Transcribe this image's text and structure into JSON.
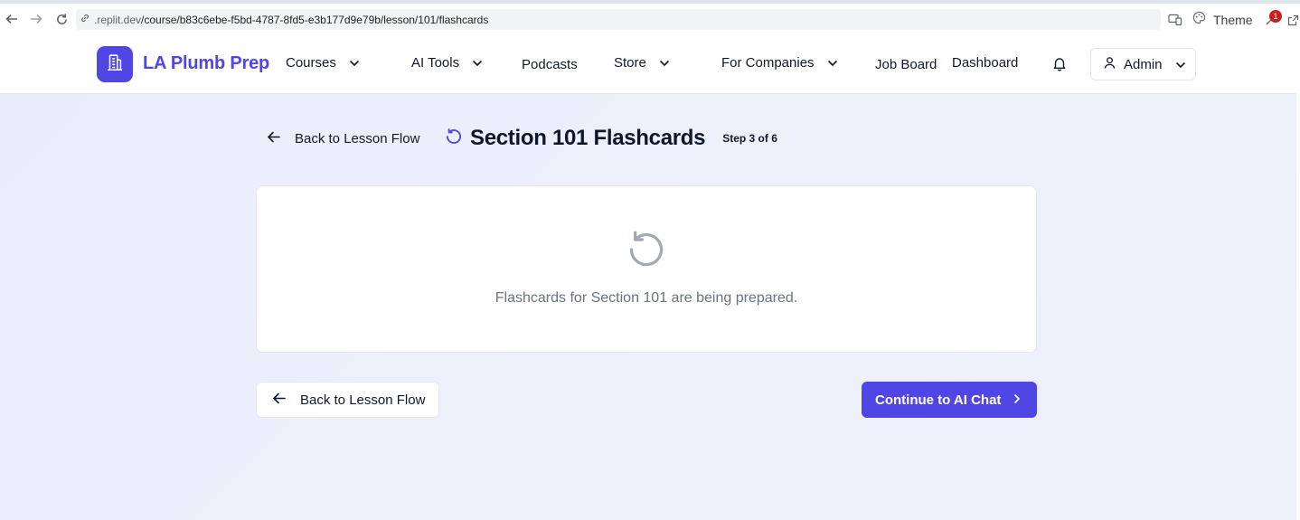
{
  "browser": {
    "url_host": ".replit.dev",
    "url_path": "/course/b83c6ebe-f5bd-4787-8fd5-e3b177d9e79b/lesson/101/flashcards",
    "theme_label": "Theme",
    "extension_badge": "1"
  },
  "header": {
    "brand": "LA Plumb Prep",
    "nav": {
      "courses": "Courses",
      "ai_tools": "AI Tools",
      "podcasts": "Podcasts",
      "store": "Store",
      "for_companies": "For Companies",
      "job_board": "Job Board",
      "dashboard": "Dashboard"
    },
    "user_menu_label": "Admin"
  },
  "main": {
    "back_link": "Back to Lesson Flow",
    "title": "Section 101 Flashcards",
    "step_badge": "Step 3 of 6",
    "empty_message": "Flashcards for Section 101 are being prepared.",
    "back_button": "Back to Lesson Flow",
    "continue_button": "Continue to AI Chat"
  },
  "colors": {
    "accent": "#4f46e5",
    "page_background": "#eef1fb",
    "muted_text": "#6b7280"
  },
  "icons": [
    "back-arrow-icon",
    "forward-arrow-icon",
    "reload-icon",
    "link-icon",
    "building-icon",
    "chevron-down-icon",
    "bell-icon",
    "user-icon",
    "arrow-left-icon",
    "rotate-ccw-icon",
    "chevron-right-icon"
  ]
}
